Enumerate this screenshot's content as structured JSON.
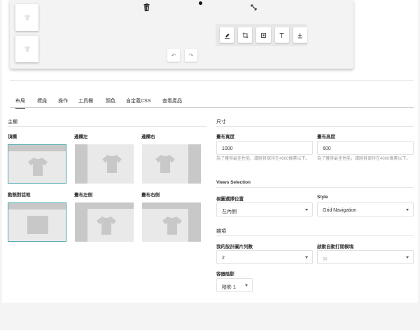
{
  "colors": {
    "accent": "#4aa6a9",
    "tile_bg": "#e9e9e9",
    "tile_dark": "#c8c8c8"
  },
  "preview": {
    "icons": [
      "trash-icon",
      "dot-icon",
      "resize-icon"
    ],
    "toolbar": [
      "brush-icon",
      "crop-icon",
      "frame-icon",
      "text-icon",
      "download-icon"
    ],
    "undo": [
      "undo-icon",
      "redo-icon"
    ]
  },
  "tabs": [
    "布局",
    "標識",
    "操作",
    "工具欄",
    "顏色",
    "自定義CSS",
    "查看產品"
  ],
  "left": {
    "section": "主欄",
    "layouts": [
      {
        "label": "頂欄"
      },
      {
        "label": "邊欄左"
      },
      {
        "label": "邊欄右"
      },
      {
        "label": "動態對話框"
      },
      {
        "label": "畫布左側"
      },
      {
        "label": "畫布右側"
      }
    ]
  },
  "right": {
    "size_section": "尺寸",
    "width_label": "畫布寬度",
    "width_value": "1000",
    "width_hint": "為了獲得最佳性能，請將其保持在4000像素以下。",
    "height_label": "畫布高度",
    "height_value": "600",
    "height_hint": "為了獲得最佳性能，請將其保持在4000像素以下。",
    "views_section": "Views Selection",
    "view_pos_label": "視圖選擇位置",
    "view_pos_value": "左內側",
    "style_label": "Style",
    "style_value": "Grid Navigation",
    "misc_section": "雜項",
    "cols_label": "我的設計圖片列數",
    "cols_value": "2",
    "auto_open_label": "啟動自動打開模塊",
    "auto_open_value": "無",
    "shadow_label": "容器陰影",
    "shadow_value": "陰影 1"
  }
}
